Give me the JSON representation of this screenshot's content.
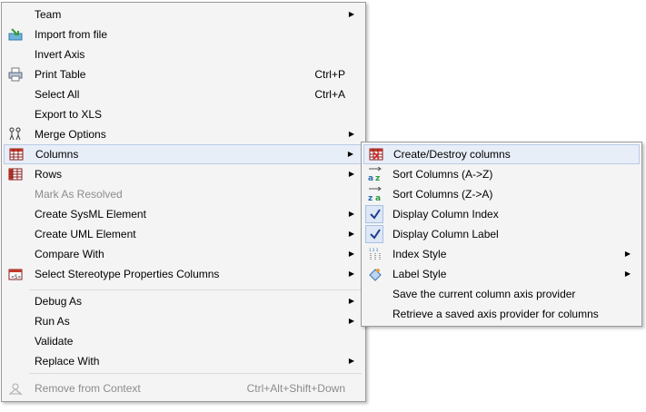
{
  "main_menu": {
    "items": [
      {
        "label": "Team",
        "shortcut": "",
        "submenu": true,
        "icon": "",
        "disabled": false
      },
      {
        "label": "Import from file",
        "shortcut": "",
        "submenu": false,
        "icon": "import-file-icon",
        "disabled": false
      },
      {
        "label": "Invert Axis",
        "shortcut": "",
        "submenu": false,
        "icon": "",
        "disabled": false
      },
      {
        "label": "Print Table",
        "shortcut": "Ctrl+P",
        "submenu": false,
        "icon": "printer-icon",
        "disabled": false
      },
      {
        "label": "Select All",
        "shortcut": "Ctrl+A",
        "submenu": false,
        "icon": "",
        "disabled": false
      },
      {
        "label": "Export to XLS",
        "shortcut": "",
        "submenu": false,
        "icon": "",
        "disabled": false
      },
      {
        "label": "Merge Options",
        "shortcut": "",
        "submenu": true,
        "icon": "merge-icon",
        "disabled": false
      },
      {
        "label": "Columns",
        "shortcut": "",
        "submenu": true,
        "icon": "table-columns-icon",
        "disabled": false,
        "highlighted": true
      },
      {
        "label": "Rows",
        "shortcut": "",
        "submenu": true,
        "icon": "table-rows-icon",
        "disabled": false
      },
      {
        "label": "Mark As Resolved",
        "shortcut": "",
        "submenu": false,
        "icon": "",
        "disabled": true
      },
      {
        "label": "Create SysML Element",
        "shortcut": "",
        "submenu": true,
        "icon": "",
        "disabled": false
      },
      {
        "label": "Create UML Element",
        "shortcut": "",
        "submenu": true,
        "icon": "",
        "disabled": false
      },
      {
        "label": "Compare With",
        "shortcut": "",
        "submenu": true,
        "icon": "",
        "disabled": false
      },
      {
        "label": "Select Stereotype Properties Columns",
        "shortcut": "",
        "submenu": true,
        "icon": "stereotype-table-icon",
        "disabled": false
      },
      {
        "label": "Debug As",
        "shortcut": "",
        "submenu": true,
        "icon": "",
        "disabled": false
      },
      {
        "label": "Run As",
        "shortcut": "",
        "submenu": true,
        "icon": "",
        "disabled": false
      },
      {
        "label": "Validate",
        "shortcut": "",
        "submenu": false,
        "icon": "",
        "disabled": false
      },
      {
        "label": "Replace With",
        "shortcut": "",
        "submenu": true,
        "icon": "",
        "disabled": false
      },
      {
        "label": "Remove from Context",
        "shortcut": "Ctrl+Alt+Shift+Down",
        "submenu": false,
        "icon": "remove-context-icon",
        "disabled": true
      }
    ]
  },
  "columns_submenu": {
    "items": [
      {
        "label": "Create/Destroy columns",
        "submenu": false,
        "icon": "create-destroy-columns-icon",
        "highlighted": true
      },
      {
        "label": "Sort Columns (A->Z)",
        "submenu": false,
        "icon": "sort-az-icon"
      },
      {
        "label": "Sort Columns (Z->A)",
        "submenu": false,
        "icon": "sort-za-icon"
      },
      {
        "label": "Display Column Index",
        "submenu": false,
        "icon": "checkmark-icon",
        "checked": true
      },
      {
        "label": "Display Column Label",
        "submenu": false,
        "icon": "checkmark-icon",
        "checked": true
      },
      {
        "label": "Index Style",
        "submenu": true,
        "icon": "index-style-icon"
      },
      {
        "label": "Label Style",
        "submenu": true,
        "icon": "label-style-icon"
      },
      {
        "label": "Save the current column axis provider",
        "submenu": false,
        "icon": ""
      },
      {
        "label": "Retrieve a saved axis provider for columns",
        "submenu": false,
        "icon": ""
      }
    ]
  },
  "colors": {
    "menu_bg": "#f4f4f4",
    "highlight_bg": "#e8eef8",
    "highlight_border": "#b9cbe6",
    "disabled_text": "#8c8c8c"
  }
}
